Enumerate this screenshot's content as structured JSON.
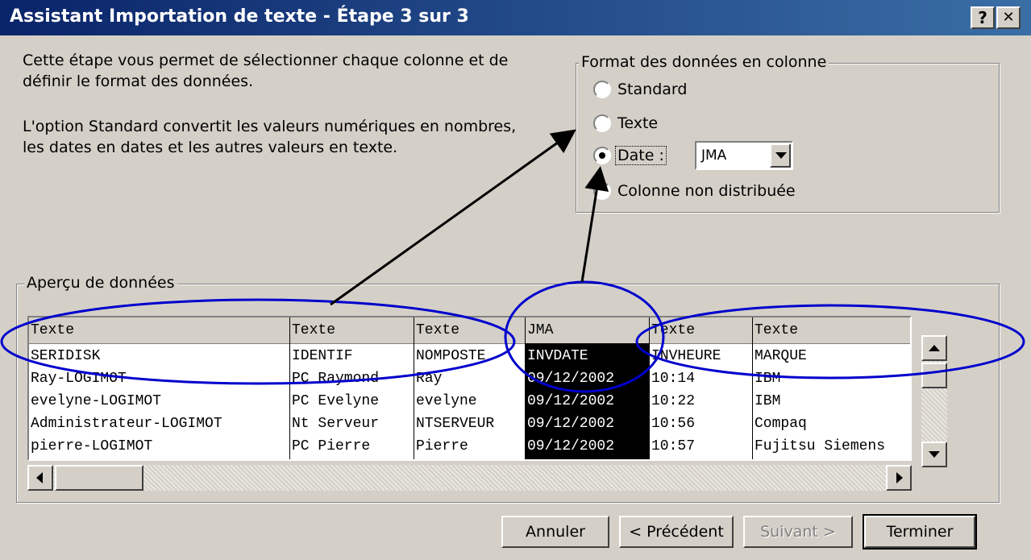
{
  "window": {
    "title": "Assistant Importation de texte - Étape 3 sur 3",
    "help_label": "?",
    "close_label": "✕"
  },
  "intro": {
    "line1": "Cette étape vous permet de sélectionner chaque colonne et de",
    "line2": "définir le format des données.",
    "line3": "L'option Standard convertit les valeurs numériques en nombres,",
    "line4": "les dates en dates et les autres valeurs en texte."
  },
  "format_group": {
    "legend": "Format des données en colonne",
    "options": [
      {
        "label": "Standard",
        "selected": false
      },
      {
        "label": "Texte",
        "selected": false
      },
      {
        "label": "Date :",
        "selected": true
      },
      {
        "label": "Colonne non distribuée",
        "selected": false
      }
    ],
    "date_format": "JMA"
  },
  "preview": {
    "legend": "Aperçu de données",
    "headers": [
      "Texte",
      "Texte",
      "Texte",
      "JMA",
      "Texte",
      "Texte"
    ],
    "rows": [
      [
        "SERIDISK",
        "IDENTIF",
        "NOMPOSTE",
        "INVDATE",
        "INVHEURE",
        "MARQUE"
      ],
      [
        "Ray-LOGIMOT",
        "PC Raymond",
        "Ray",
        "09/12/2002",
        "10:14",
        "IBM"
      ],
      [
        "evelyne-LOGIMOT",
        "PC Evelyne",
        "evelyne",
        "09/12/2002",
        "10:22",
        "IBM"
      ],
      [
        "Administrateur-LOGIMOT",
        "Nt Serveur",
        "NTSERVEUR",
        "09/12/2002",
        "10:56",
        "Compaq"
      ],
      [
        "pierre-LOGIMOT",
        "PC Pierre",
        "Pierre",
        "09/12/2002",
        "10:57",
        "Fujitsu Siemens"
      ]
    ]
  },
  "buttons": {
    "cancel": "Annuler",
    "previous": "< Précédent",
    "next": "Suivant >",
    "finish": "Terminer"
  },
  "colors": {
    "titlebar": "#0a246a",
    "annotation_ellipse": "#0000cc",
    "face": "#d4d0c8"
  }
}
